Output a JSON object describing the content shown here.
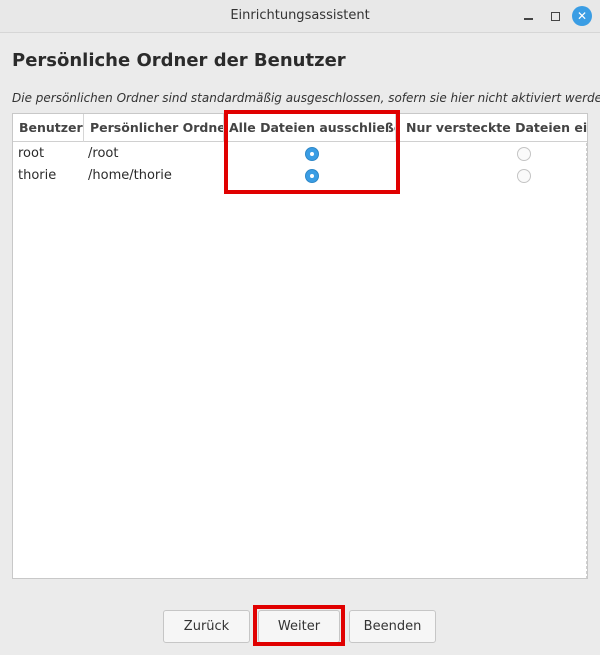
{
  "window": {
    "title": "Einrichtungsassistent",
    "controls": [
      "minimize-icon",
      "maximize-icon",
      "close-icon"
    ],
    "close_symbol": "✕",
    "accent_color": "#3a9de4",
    "highlight_color": "#e00000"
  },
  "page": {
    "heading": "Persönliche Ordner der Benutzer",
    "description": "Die persönlichen Ordner sind standardmäßig ausgeschlossen, sofern sie hier nicht aktiviert werden."
  },
  "table": {
    "columns": [
      "Benutzer",
      "Persönlicher Ordner",
      "Alle Dateien ausschließen",
      "Nur versteckte Dateien einschließen"
    ],
    "rows": [
      {
        "user": "root",
        "folder": "/root",
        "exclude_all": true,
        "hidden_only": false
      },
      {
        "user": "thorie",
        "folder": "/home/thorie",
        "exclude_all": true,
        "hidden_only": false
      }
    ]
  },
  "buttons": {
    "back": "Zurück",
    "next": "Weiter",
    "finish": "Beenden"
  }
}
